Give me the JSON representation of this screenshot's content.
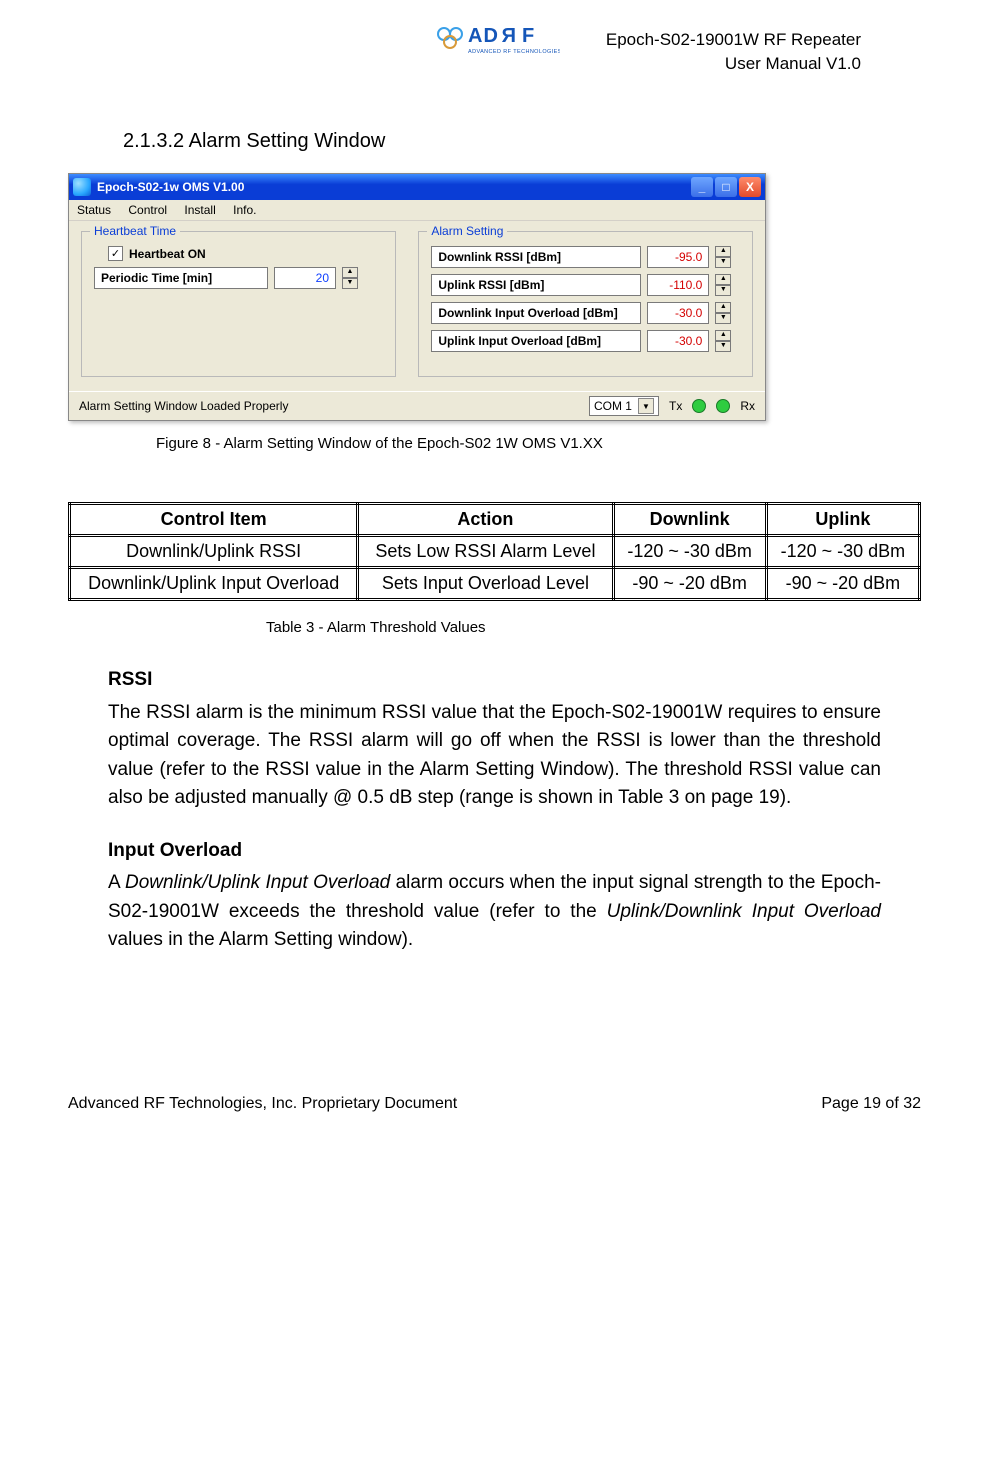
{
  "header": {
    "line1": "Epoch-S02-19001W RF Repeater",
    "line2": "User Manual V1.0"
  },
  "logo": {
    "brand": "ADRF",
    "subtitle": "ADVANCED RF TECHNOLOGIES"
  },
  "section": {
    "number": "2.1.3.2",
    "title": "Alarm Setting Window"
  },
  "window": {
    "title": "Epoch-S02-1w OMS V1.00",
    "menus": [
      "Status",
      "Control",
      "Install",
      "Info."
    ],
    "heartbeat": {
      "legend": "Heartbeat Time",
      "checkbox_label": "Heartbeat ON",
      "checkbox_checked": true,
      "periodic_label": "Periodic Time [min]",
      "periodic_value": "20"
    },
    "alarm": {
      "legend": "Alarm Setting",
      "rows": [
        {
          "label": "Downlink RSSI  [dBm]",
          "value": "-95.0"
        },
        {
          "label": "Uplink RSSI  [dBm]",
          "value": "-110.0"
        },
        {
          "label": "Downlink Input Overload [dBm]",
          "value": "-30.0"
        },
        {
          "label": "Uplink Input Overload [dBm]",
          "value": "-30.0"
        }
      ]
    },
    "status_text": "Alarm Setting Window Loaded Properly",
    "com_label": "COM 1",
    "tx_label": "Tx",
    "rx_label": "Rx"
  },
  "figure_caption": "Figure 8 - Alarm Setting Window of the Epoch-S02 1W OMS V1.XX",
  "table": {
    "headers": [
      "Control Item",
      "Action",
      "Downlink",
      "Uplink"
    ],
    "rows": [
      {
        "item": "Downlink/Uplink RSSI",
        "action": "Sets Low RSSI Alarm Level",
        "downlink": "-120 ~ -30 dBm",
        "uplink": "-120 ~ -30 dBm"
      },
      {
        "item": "Downlink/Uplink Input Overload",
        "action": "Sets Input Overload Level",
        "downlink": "-90 ~ -20 dBm",
        "uplink": "-90 ~ -20 dBm"
      }
    ]
  },
  "table_caption": "Table 3 - Alarm Threshold Values",
  "body": {
    "rssi_heading": "RSSI",
    "rssi_text": "The RSSI alarm is the minimum RSSI value that the Epoch-S02-19001W requires to ensure optimal coverage.  The RSSI alarm will go off when the RSSI is lower than the threshold value (refer to the RSSI value in the Alarm Setting Window). The threshold RSSI value can also be adjusted manually @ 0.5 dB step (range is shown in Table 3 on page 19).",
    "io_heading": "Input Overload",
    "io_pre": "A ",
    "io_em1": "Downlink/Uplink Input Overload",
    "io_mid": " alarm occurs when the input signal strength to the Epoch-S02-19001W exceeds the threshold value (refer to the ",
    "io_em2": "Uplink/Downlink Input Overload",
    "io_post": " values in the Alarm Setting window)."
  },
  "footer": {
    "left": "Advanced RF Technologies, Inc. Proprietary Document",
    "right": "Page 19 of 32"
  },
  "chart_data": {
    "type": "table",
    "title": "Alarm Threshold Values",
    "columns": [
      "Control Item",
      "Action",
      "Downlink",
      "Uplink"
    ],
    "rows": [
      [
        "Downlink/Uplink RSSI",
        "Sets Low RSSI Alarm Level",
        "-120 ~ -30 dBm",
        "-120 ~ -30 dBm"
      ],
      [
        "Downlink/Uplink Input Overload",
        "Sets Input Overload Level",
        "-90 ~ -20 dBm",
        "-90 ~ -20 dBm"
      ]
    ]
  }
}
